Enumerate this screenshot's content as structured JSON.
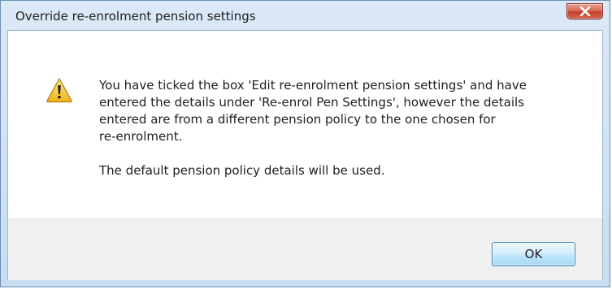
{
  "dialog": {
    "title": "Override re-enrolment pension settings",
    "close_icon": "close-icon",
    "icon": "warning-icon",
    "message": {
      "line1": "You have ticked the box 'Edit re-enrolment pension settings' and have",
      "line2": "entered the details under 'Re-enrol Pen Settings', however the details",
      "line3": "entered are from a different pension policy to the one chosen for",
      "line4": "re-enrolment.",
      "line5": "The default pension policy details will be used."
    },
    "ok_label": "OK"
  },
  "colors": {
    "close_button": "#c1402a",
    "warning_fill": "#f3c531",
    "ok_border": "#3c7fb1"
  }
}
